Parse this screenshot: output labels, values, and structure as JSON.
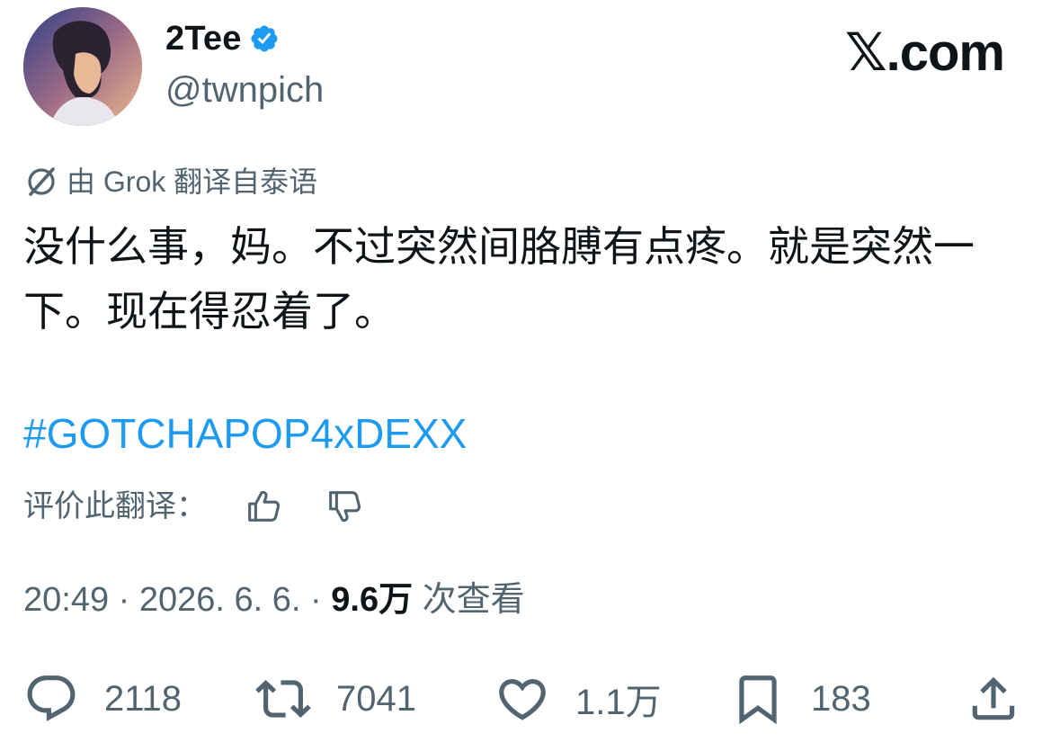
{
  "author": {
    "display_name": "2Tee",
    "handle": "@twnpich",
    "verified": true
  },
  "brand": "𝕏.com",
  "translation": {
    "label": "由 Grok 翻译自泰语"
  },
  "tweet": {
    "text": "没什么事，妈。不过突然间胳膊有点疼。就是突然一下。现在得忍着了。",
    "hashtag": "#GOTCHAPOP4xDEXX"
  },
  "rate_translation": {
    "label": "评价此翻译："
  },
  "meta": {
    "time": "20:49",
    "separator": " · ",
    "date": "2026. 6. 6.",
    "views_count": "9.6万",
    "views_label": "次查看"
  },
  "actions": {
    "reply_count": "2118",
    "repost_count": "7041",
    "like_count": "1.1万",
    "bookmark_count": "183"
  },
  "colors": {
    "accent": "#1d9bf0",
    "secondary_text": "#536471",
    "primary_text": "#0f1419"
  },
  "icons": {
    "verified": "verified-badge-icon",
    "translate": "grok-translate-icon",
    "thumbs_up": "thumbs-up-icon",
    "thumbs_down": "thumbs-down-icon",
    "reply": "reply-icon",
    "repost": "repost-icon",
    "like": "heart-icon",
    "bookmark": "bookmark-icon",
    "share": "share-icon"
  }
}
